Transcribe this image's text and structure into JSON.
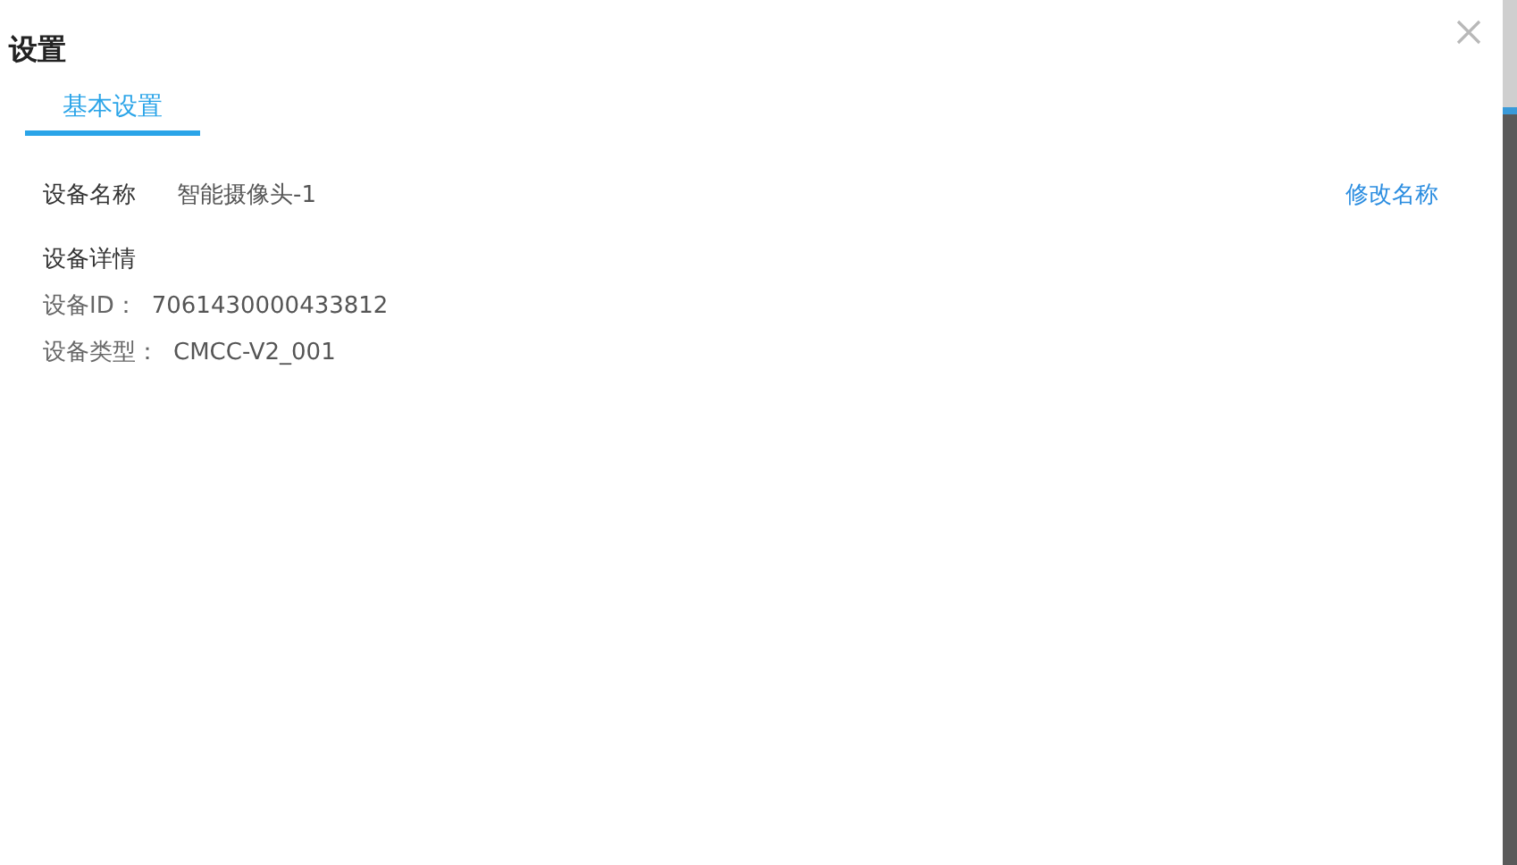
{
  "dialog": {
    "title": "设置"
  },
  "tabs": [
    {
      "label": "基本设置",
      "selected": true
    }
  ],
  "device_name": {
    "label": "设备名称",
    "value": "智能摄像头-1",
    "action": "修改名称"
  },
  "details": {
    "heading": "设备详情",
    "fields": [
      {
        "label": "设备ID：",
        "value": "7061430000433812"
      },
      {
        "label": "设备类型：",
        "value": "CMCC-V2_001"
      }
    ]
  }
}
